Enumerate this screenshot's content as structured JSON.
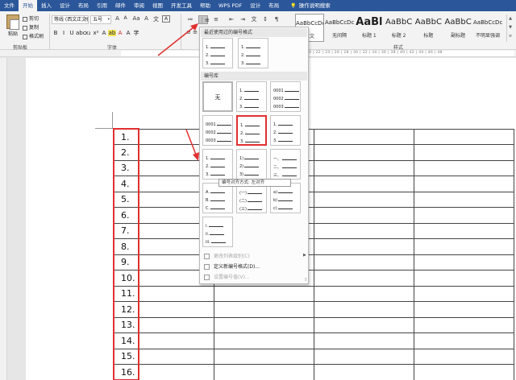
{
  "tabs": [
    "文件",
    "开始",
    "插入",
    "设计",
    "布局",
    "引用",
    "邮件",
    "审阅",
    "视图",
    "开发工具",
    "帮助",
    "WPS PDF",
    "设计",
    "布局",
    "操作说明搜索"
  ],
  "active_tab_index": 1,
  "clipboard": {
    "paste": "粘贴",
    "cut": "剪切",
    "copy": "复制",
    "format_painter": "格式刷",
    "group": "剪贴板"
  },
  "font": {
    "name": "等线 (西文正文)",
    "size": "五号",
    "group": "字体",
    "buttons_top": [
      "A",
      "A",
      "Aa",
      "A",
      "文"
    ],
    "buttons_fmt": [
      "B",
      "I",
      "U",
      "abc",
      "x₂",
      "x²",
      "A",
      "ab",
      "A",
      "A",
      "字"
    ]
  },
  "paragraph": {
    "row1": [
      "≔",
      "⋮≡",
      "≡",
      "⇤",
      "⇥",
      "文",
      "↕",
      "¶"
    ],
    "row2": "≡ ≡ ≡ ≡ ⊟ ↕ ◇ ⊞"
  },
  "styles": {
    "group": "样式",
    "items": [
      {
        "preview": "AaBbCcDc",
        "name": "正文"
      },
      {
        "preview": "AaBbCcDc",
        "name": "无间隔"
      },
      {
        "preview": "AaBl",
        "name": "标题 1"
      },
      {
        "preview": "AaBbC",
        "name": "标题 2"
      },
      {
        "preview": "AaBbC",
        "name": "标题"
      },
      {
        "preview": "AaBbC",
        "name": "副标题"
      },
      {
        "preview": "AaBbCcDc",
        "name": "不明显强调"
      }
    ]
  },
  "ruler_numbers": "20 | 22 | 24 | 26 | 28 | 30 | 32 | 34 | 36 | 38 | 40 | 42 | 44 | 46 | 48",
  "numbering_menu": {
    "recent_header": "最近使用过的编号格式",
    "library_header": "编号库",
    "none_label": "无",
    "recent": [
      [
        "1.",
        "2.",
        "3."
      ],
      [
        "1.",
        "2.",
        "3."
      ]
    ],
    "library": [
      [
        "1.",
        "2.",
        "3."
      ],
      [
        "0001",
        "0002",
        "0003"
      ],
      [
        "0001",
        "0002",
        "0003"
      ],
      [
        "1.",
        "2.",
        "3."
      ],
      [
        "1.",
        "2.",
        "3."
      ],
      [
        "1.",
        "2.",
        "3."
      ],
      [
        "1)",
        "2)",
        "3)"
      ],
      [
        "一、",
        "二、",
        "三、"
      ],
      [
        "A.",
        "B.",
        "C."
      ],
      [
        "(一)",
        "(二)",
        "(三)"
      ],
      [
        "a)",
        "b)",
        "c)"
      ],
      [
        "i.",
        "ii.",
        "iii."
      ]
    ],
    "tooltip": "编号对齐方式: 左对齐",
    "menu_items": [
      {
        "label": "更改列表级别(C)",
        "disabled": true
      },
      {
        "label": "定义新编号格式(D)...",
        "disabled": false
      },
      {
        "label": "设置编号值(V)...",
        "disabled": true
      }
    ]
  },
  "table_numbers": [
    "1.",
    "2.",
    "3.",
    "4.",
    "5.",
    "6.",
    "7.",
    "8.",
    "9.",
    "10.",
    "11.",
    "12.",
    "13.",
    "14.",
    "15.",
    "16."
  ],
  "colors": {
    "ribbon_blue": "#2b579a",
    "annotation_red": "#e03030"
  }
}
